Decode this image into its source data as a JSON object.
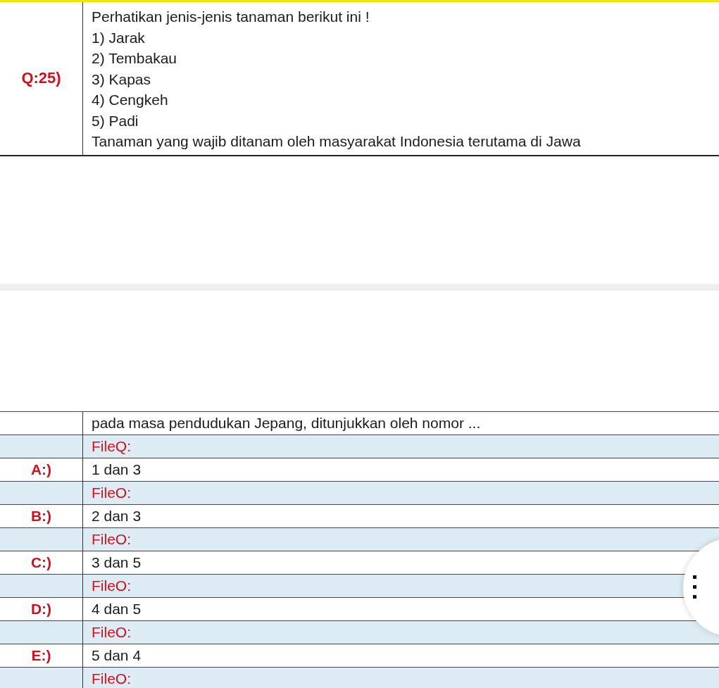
{
  "question": {
    "number": "Q:25)",
    "lines": [
      "Perhatikan jenis-jenis tanaman berikut ini !",
      "1) Jarak",
      "2) Tembakau",
      "3) Kapas",
      "4) Cengkeh",
      "5) Padi",
      "Tanaman yang wajib ditanam oleh masyarakat Indonesia terutama di Jawa"
    ]
  },
  "continuation": {
    "text": "pada masa pendudukan Jepang, ditunjukkan oleh nomor ...",
    "file_label": "FileQ:"
  },
  "options": [
    {
      "label": "A:)",
      "text": "1 dan 3",
      "file_label": "FileO:"
    },
    {
      "label": "B:)",
      "text": "2 dan 3",
      "file_label": "FileO:"
    },
    {
      "label": "C:)",
      "text": "3 dan 5",
      "file_label": "FileO:"
    },
    {
      "label": "D:)",
      "text": "4 dan 5",
      "file_label": "FileO:"
    },
    {
      "label": "E:)",
      "text": "5 dan 4",
      "file_label": "FileO:"
    }
  ]
}
